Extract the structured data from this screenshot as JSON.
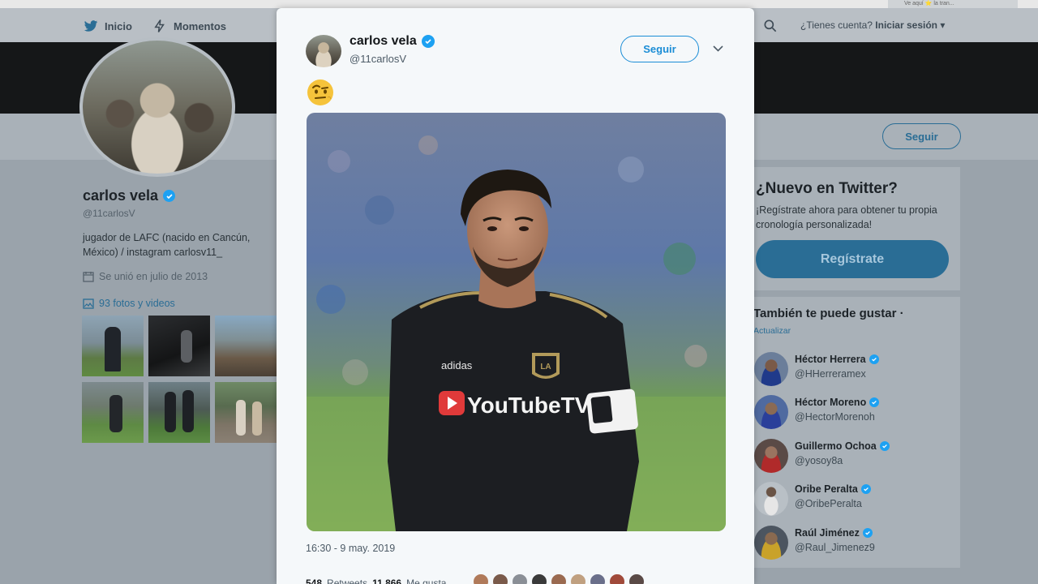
{
  "browser": {
    "tab_text": "Ve aquí ⭐ la tran..."
  },
  "nav": {
    "home_label": "Inicio",
    "moments_label": "Momentos",
    "account_prompt": "¿Tienes cuenta?",
    "login_label": "Iniciar sesión ▾"
  },
  "profile": {
    "name": "carlos vela",
    "handle": "@11carlosV",
    "bio": "jugador de LAFC (nacido en Cancún, México) / instagram carlosv11_",
    "joined": "Se unió en julio de 2013",
    "media_link": "93 fotos y videos",
    "follow_label": "Seguir"
  },
  "signup_card": {
    "title": "¿Nuevo en Twitter?",
    "text": "¡Regístrate ahora para obtener tu propia cronología personalizada!",
    "button": "Regístrate"
  },
  "suggestions": {
    "title": "También te puede gustar ·",
    "refresh": "Actualizar",
    "items": [
      {
        "name": "Héctor Herrera",
        "handle": "@HHerreramex"
      },
      {
        "name": "Héctor Moreno",
        "handle": "@HectorMorenoh"
      },
      {
        "name": "Guillermo Ochoa",
        "handle": "@yosoy8a"
      },
      {
        "name": "Oribe Peralta",
        "handle": "@OribePeralta"
      },
      {
        "name": "Raúl Jiménez",
        "handle": "@Raul_Jimenez9"
      }
    ]
  },
  "tweet": {
    "name": "carlos vela",
    "handle": "@11carlosV",
    "follow_label": "Seguir",
    "emoji": "🤨",
    "photo_sponsor": "YouTubeTV",
    "photo_brand": "adidas",
    "photo_crest": "LA",
    "timestamp": "16:30 - 9 may. 2019",
    "retweets": "548",
    "retweets_label": "Retweets",
    "likes": "11.866",
    "likes_label": "Me gusta"
  },
  "colors": {
    "accent": "#1da1f2",
    "dim_accent": "#2a6d95",
    "modal_bg": "#f5f8fa",
    "backdrop": "#9aa3ab"
  }
}
